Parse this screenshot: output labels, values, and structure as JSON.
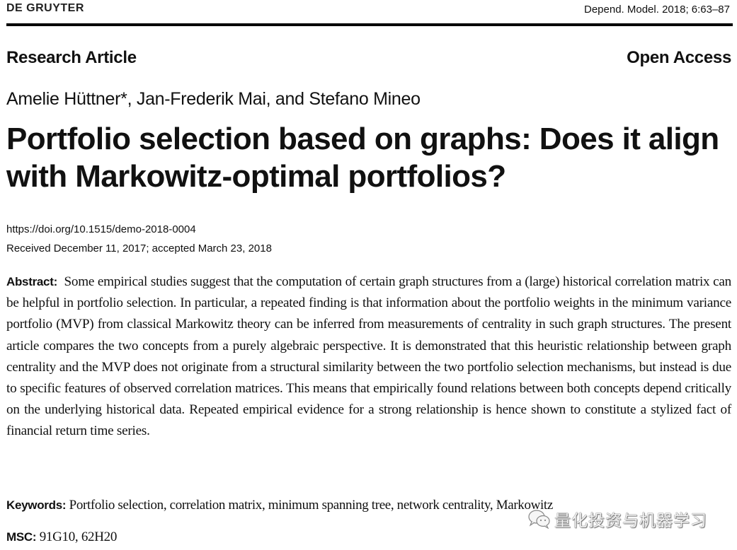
{
  "header": {
    "publisher": "DE GRUYTER",
    "citation": "Depend. Model. 2018; 6:63–87"
  },
  "article_type": "Research Article",
  "access": "Open Access",
  "authors": "Amelie Hüttner*, Jan-Frederik Mai, and Stefano Mineo",
  "title": "Portfolio selection based on graphs: Does it align with Markowitz-optimal portfolios?",
  "doi": "https://doi.org/10.1515/demo-2018-0004",
  "dates": "Received December 11, 2017; accepted March 23, 2018",
  "abstract": {
    "label": "Abstract:",
    "text": "Some empirical studies suggest that the computation of certain graph structures from a (large) historical correlation matrix can be helpful in portfolio selection. In particular, a repeated finding is that information about the portfolio weights in the minimum variance portfolio (MVP) from classical Markowitz theory can be inferred from measurements of centrality in such graph structures. The present article compares the two concepts from a purely algebraic perspective. It is demonstrated that this heuristic relationship between graph centrality and the MVP does not originate from a structural similarity between the two portfolio selection mechanisms, but instead is due to specific features of observed correlation matrices. This means that empirically found relations between both concepts depend critically on the underlying historical data. Repeated empirical evidence for a strong relationship is hence shown to constitute a stylized fact of financial return time series."
  },
  "keywords": {
    "label": "Keywords:",
    "text": "Portfolio selection, correlation matrix, minimum spanning tree, network centrality, Markowitz"
  },
  "msc": {
    "label": "MSC:",
    "text": "91G10, 62H20"
  },
  "watermark": {
    "icon": "wechat-icon",
    "text": "量化投资与机器学习"
  }
}
